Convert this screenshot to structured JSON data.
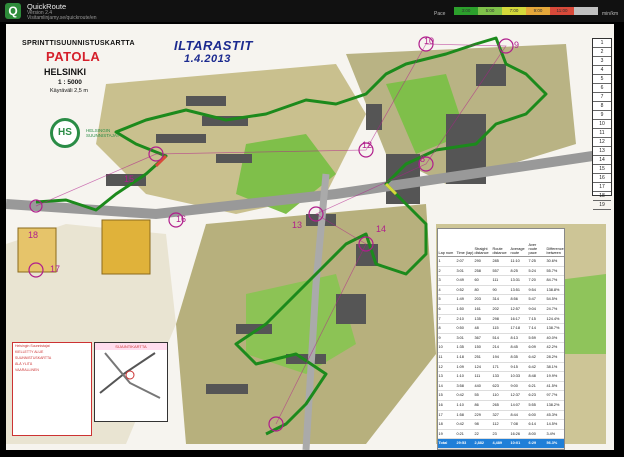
{
  "app": {
    "title": "QuickRoute",
    "version": "Version 2.4",
    "subtitle": "Visitamlinjamy.se/quickroute/en",
    "icon": "quickroute-logo-icon"
  },
  "pace_legend": {
    "label": "Pace",
    "unit": "min/km",
    "ticks": [
      "3:00",
      "5:00",
      "7:00",
      "9:00",
      "11:00",
      ""
    ],
    "colors": [
      "#2ca02c",
      "#7fc24a",
      "#d4d93a",
      "#e6a83a",
      "#d94a3a",
      "#c0c0c0"
    ]
  },
  "map": {
    "club_title": "SPRINTTISUUNNISTUSKARTTA",
    "name": "PATOLA",
    "city": "HELSINKI",
    "scale": "1 : 5000",
    "contour": "Käyräväli 2,5 m",
    "club_logo_text": "HS",
    "club_name": "HELSINGIN SUUNNISTAJAT",
    "event_title": "ILTARASTIT",
    "event_date": "1.4.2013",
    "inset_title": "SIJAINTIKARTTA",
    "legend_lines": [
      "Helsingin Suunnistajat",
      "KIELLETTY ALUE",
      "SUUNNISTUSKARTTA",
      "ÄLÄ YLITÄ",
      "VAARALLINEN"
    ]
  },
  "control_description_rows": [
    "1",
    "2",
    "3",
    "4",
    "5",
    "6",
    "7",
    "8",
    "9",
    "10",
    "11",
    "12",
    "13",
    "14",
    "15",
    "16",
    "17",
    "18",
    "19"
  ],
  "control_numbers": [
    "10",
    "9",
    "8",
    "12",
    "13",
    "14",
    "15",
    "16",
    "17",
    "18"
  ],
  "splits": {
    "headers": [
      "Lap num",
      "Time (lap)",
      "Straight distance",
      "Route distance",
      "Average straight",
      "Average route",
      "Aver route pace",
      "Difference between"
    ],
    "rows": [
      [
        "1",
        "2:07",
        "290",
        "285",
        "11:10",
        "7:25",
        "30.6%"
      ],
      [
        "2",
        "3:01",
        "258",
        "557",
        "8:25",
        "5:24",
        "55.7%"
      ],
      [
        "3",
        "0:49",
        "60",
        "111",
        "13:31",
        "7:20",
        "84.7%"
      ],
      [
        "4",
        "0:52",
        "80",
        "90",
        "13:51",
        "9:54",
        "138.8%"
      ],
      [
        "5",
        "1:49",
        "203",
        "314",
        "8:56",
        "5:47",
        "54.5%"
      ],
      [
        "6",
        "1:50",
        "161",
        "202",
        "12:57",
        "9:04",
        "24.7%"
      ],
      [
        "7",
        "2:10",
        "135",
        "298",
        "16:17",
        "7:15",
        "124.4%"
      ],
      [
        "8",
        "0:50",
        "48",
        "115",
        "17:18",
        "7:14",
        "138.7%"
      ],
      [
        "9",
        "3:01",
        "367",
        "514",
        "8:13",
        "5:59",
        "40.0%"
      ],
      [
        "10",
        "1:35",
        "150",
        "214",
        "8:45",
        "6:09",
        "42.2%"
      ],
      [
        "11",
        "1:18",
        "251",
        "194",
        "8:35",
        "6:42",
        "28.2%"
      ],
      [
        "12",
        "1:09",
        "124",
        "171",
        "9:15",
        "6:42",
        "38.1%"
      ],
      [
        "13",
        "1:10",
        "111",
        "133",
        "10:33",
        "8:48",
        "19.9%"
      ],
      [
        "14",
        "3:58",
        "440",
        "623",
        "9:00",
        "6:21",
        "41.5%"
      ],
      [
        "15",
        "0:42",
        "55",
        "110",
        "12:37",
        "6:23",
        "97.7%"
      ],
      [
        "16",
        "1:10",
        "86",
        "265",
        "14:07",
        "5:55",
        "138.2%"
      ],
      [
        "17",
        "1:58",
        "229",
        "327",
        "8:44",
        "6:00",
        "45.3%"
      ],
      [
        "18",
        "0:42",
        "98",
        "112",
        "7:08",
        "6:14",
        "14.5%"
      ],
      [
        "19",
        "0:21",
        "22",
        "23",
        "16:26",
        "8:00",
        "3.4%"
      ]
    ],
    "total": [
      "Total",
      "29:53",
      "2,882",
      "4,489",
      "10:01",
      "6:29",
      "56.3%"
    ]
  }
}
